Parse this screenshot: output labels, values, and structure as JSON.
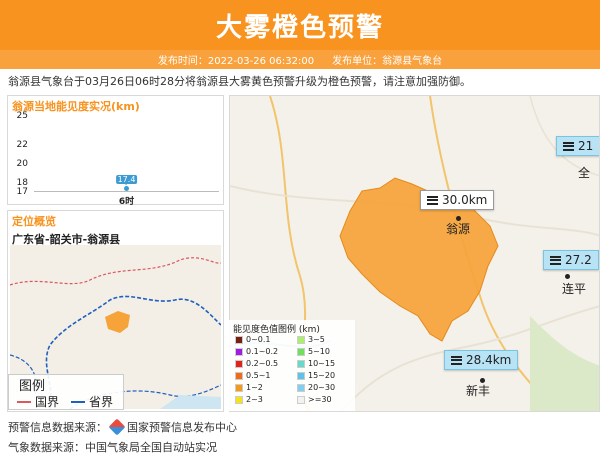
{
  "header": {
    "title": "大雾橙色预警",
    "publish_time_label": "发布时间：2022-03-26 06:32:00",
    "publisher_label": "发布单位：翁源县气象台"
  },
  "content": "翁源县气象台于03月26日06时28分将翁源县大雾黄色预警升级为橙色预警，请注意加强防御。",
  "visibility_panel": {
    "title": "翁源当地能见度实况(km)"
  },
  "chart_data": {
    "type": "line",
    "title": "翁源当地能见度实况(km)",
    "categories": [
      "6时"
    ],
    "values": [
      17.4
    ],
    "y_ticks": [
      "25",
      "22",
      "20",
      "18",
      "17"
    ],
    "ylim": [
      17,
      25
    ],
    "point_color": "#3d9bd4"
  },
  "location_panel": {
    "title": "定位概览",
    "path": "广东省-韶关市-翁源县",
    "legend": {
      "title": "图例",
      "items": [
        {
          "label": "国界",
          "color": "#d9595f"
        },
        {
          "label": "省界",
          "color": "#1f5fbf"
        }
      ]
    }
  },
  "map": {
    "callouts": [
      {
        "text": "30.0km",
        "style": "white"
      },
      {
        "text": "21",
        "style": "blue"
      },
      {
        "text": "27.2",
        "style": "blue"
      },
      {
        "text": "28.4km",
        "style": "blue"
      }
    ],
    "places": [
      "翁源",
      "全",
      "连平",
      "新丰"
    ],
    "warning_area_color": "#f6a33a"
  },
  "vis_legend": {
    "title": "能见度色值图例 (km)",
    "items": [
      {
        "label": "0~0.1",
        "color": "#7a1f10"
      },
      {
        "label": "0.1~0.2",
        "color": "#a21be0"
      },
      {
        "label": "0.2~0.5",
        "color": "#e2231a"
      },
      {
        "label": "0.5~1",
        "color": "#f06a1a"
      },
      {
        "label": "1~2",
        "color": "#f59a16"
      },
      {
        "label": "2~3",
        "color": "#f4e21a"
      },
      {
        "label": "3~5",
        "color": "#aaf06a"
      },
      {
        "label": "5~10",
        "color": "#6fe05a"
      },
      {
        "label": "10~15",
        "color": "#66d9c9"
      },
      {
        "label": "15~20",
        "color": "#5fc2e8"
      },
      {
        "label": "20~30",
        "color": "#7fd0f0"
      },
      {
        "label": ">=30",
        "color": "#f2f2f2"
      }
    ]
  },
  "footer": {
    "warning_source": "预警信息数据来源：",
    "warning_source_name": "国家预警信息发布中心",
    "weather_source": "气象数据来源：中国气象局全国自动站实况"
  }
}
